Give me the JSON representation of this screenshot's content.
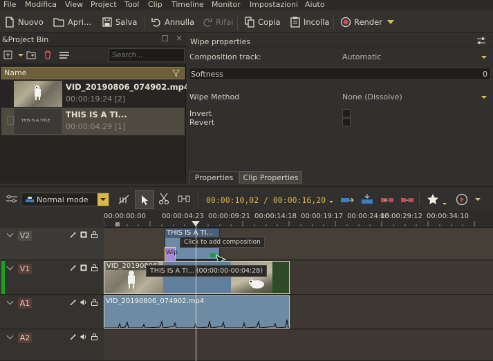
{
  "menubar": {
    "items": [
      "File",
      "Modifica",
      "View",
      "Project",
      "Tool",
      "Clip",
      "Timeline",
      "Monitor",
      "Impostazioni",
      "Aiuto"
    ]
  },
  "toolbar": {
    "new_label": "Nuovo",
    "open_label": "Apri...",
    "save_label": "Salva",
    "undo_label": "Annulla",
    "redo_label": "Rifai",
    "copy_label": "Copia",
    "paste_label": "Incolla",
    "render_label": "Render"
  },
  "project_bin": {
    "title": "&Project Bin",
    "search_placeholder": "Search...",
    "column_name": "Name",
    "clips": [
      {
        "name": "VID_20190806_074902.mp4",
        "duration": "00:00:19:24 [2]"
      },
      {
        "name": "THIS IS A TI...",
        "duration": "00:00:04:29 [1]",
        "thumb_text": "THIS IS A TITLE"
      }
    ]
  },
  "wipe_properties": {
    "title": "Wipe properties",
    "composition_track_label": "Composition track:",
    "composition_track_value": "Automatic",
    "softness_label": "Softness",
    "softness_value": "0",
    "wipe_method_label": "Wipe Method",
    "wipe_method_value": "None (Dissolve)",
    "invert_label": "Invert",
    "revert_label": "Revert",
    "invert_checked": false,
    "revert_checked": false
  },
  "tabs": [
    "Properties",
    "Clip Properties"
  ],
  "timeline_toolbar": {
    "mode_label": "Normal mode",
    "timecode": "00:00:10,02 / 00:00:16,20"
  },
  "ruler": {
    "labels": [
      "00:00:00:00",
      "00:00:04:23",
      "00:00:09:21",
      "00:00:14:18",
      "00:00:19:17",
      "00:00:24:15",
      "00:00:29:12",
      "00:00:34:10"
    ]
  },
  "tracks": [
    {
      "name": "V2",
      "type": "video"
    },
    {
      "name": "V1",
      "type": "video"
    },
    {
      "name": "A1",
      "type": "audio"
    },
    {
      "name": "A2",
      "type": "audio"
    }
  ],
  "timeline_clips": {
    "title_clip_label": "THIS IS A TI...",
    "composition_label": "Wip",
    "tooltip_add_composition": "Click to add composition",
    "tooltip_title_clip": "THIS IS A TI... (00:00:00-00:04:28)",
    "video_clip_label": "VID_20190806",
    "audio_clip_label": "VID_20190806_074902.mp4"
  },
  "colors": {
    "accent_yellow": "#e0b43c",
    "selection": "#6b5f3c",
    "audio_clip": "#6d8ba3",
    "v1_active_bar": "#1aa31a",
    "composition": "#9f87c9"
  }
}
